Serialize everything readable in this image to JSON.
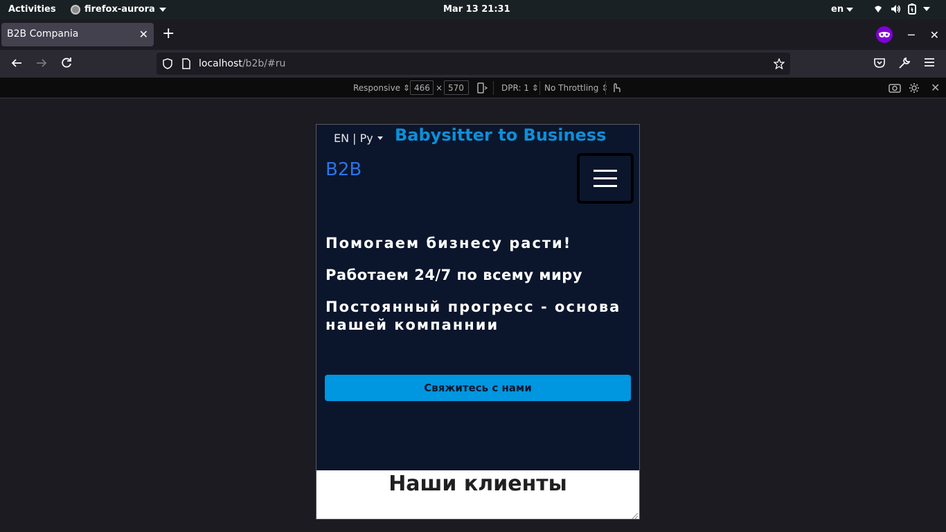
{
  "system_bar": {
    "activities": "Activities",
    "app_name": "firefox-aurora",
    "clock": "Mar 13  21:31",
    "keyboard_layout": "en"
  },
  "browser": {
    "tab_title": "B2B Compania",
    "url_host": "localhost",
    "url_path": "/b2b/#ru"
  },
  "rdm": {
    "device": "Responsive",
    "width": "466",
    "times": "×",
    "height": "570",
    "dpr": "DPR: 1",
    "throttling": "No Throttling"
  },
  "page": {
    "language_switch": "EN | Ру",
    "site_title": "Babysitter to Business",
    "brand": "B2B",
    "hero_lines": [
      "Помогаем бизнесу расти!",
      "Работаем 24/7 по всему миру",
      "Постоянный прогресс - основа нашей компаннии"
    ],
    "cta_label": "Свяжитесь с нами",
    "clients_title": "Наши клиенты"
  },
  "colors": {
    "page_bg": "#0b162c",
    "site_title": "#0d8fd9",
    "brand": "#2a74e8",
    "cta_bg": "#0096e0",
    "private_badge": "#8000d7"
  }
}
